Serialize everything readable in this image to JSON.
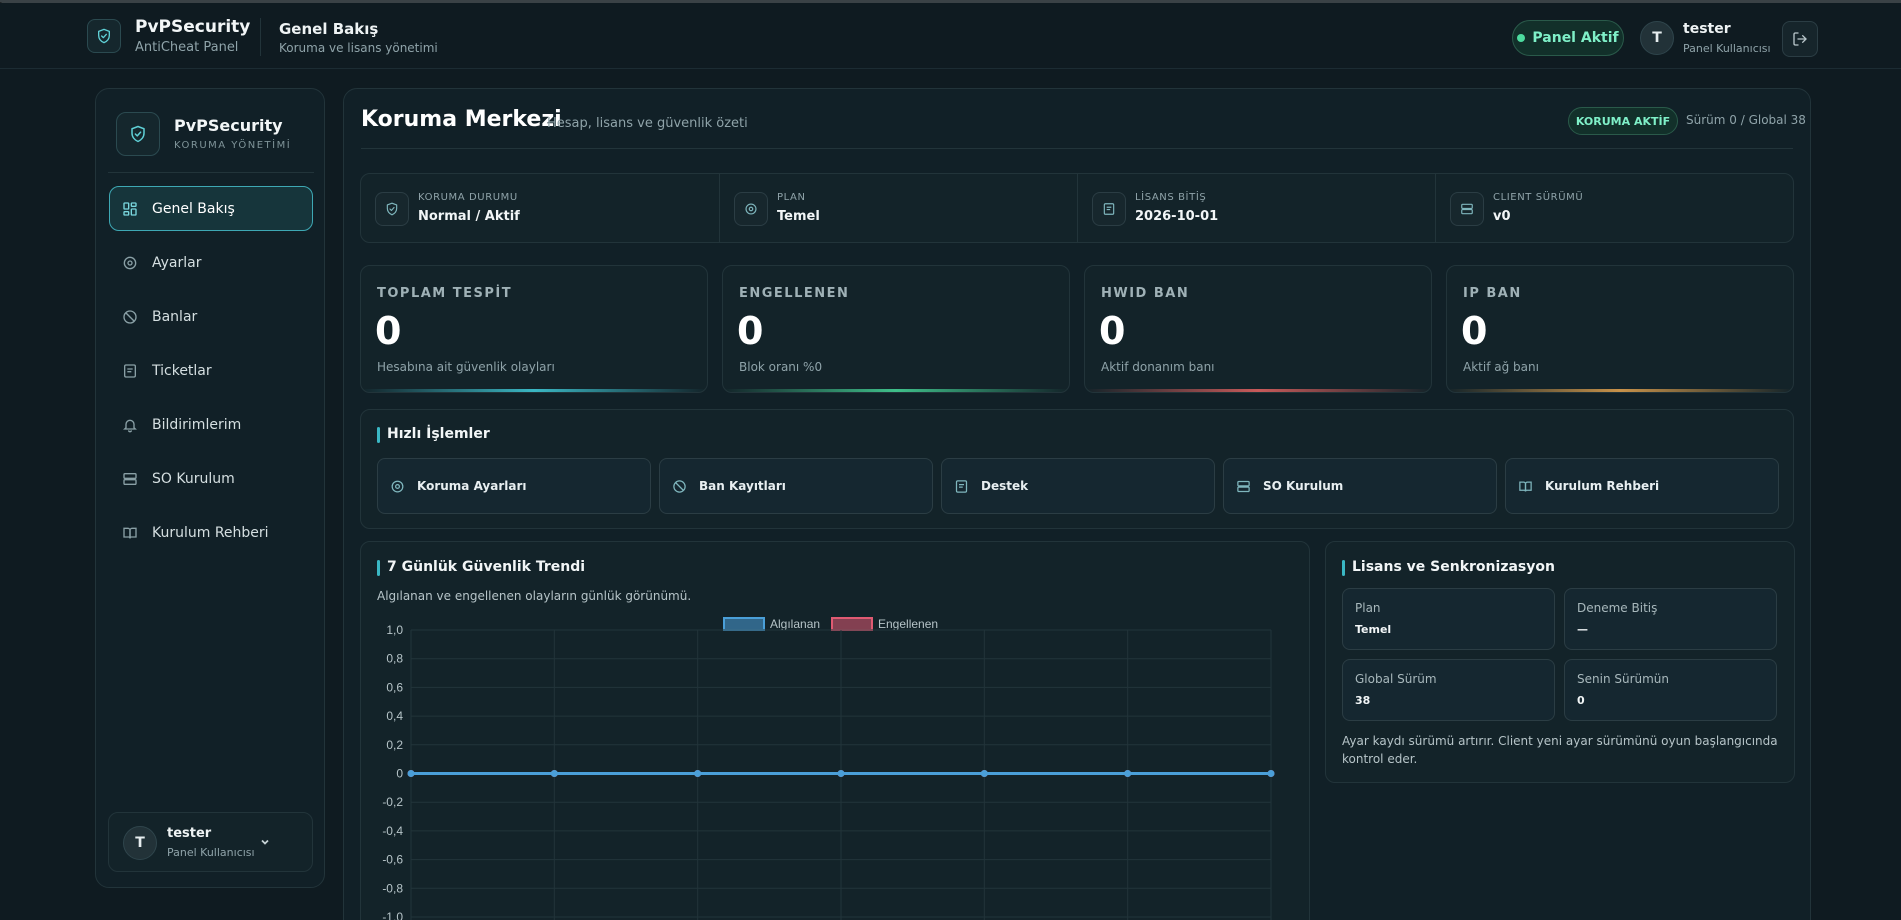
{
  "header": {
    "brand_name": "PvPSecurity",
    "brand_sub": "AntiCheat Panel",
    "title": "Genel Bakış",
    "subtitle": "Koruma ve lisans yönetimi",
    "status_pill": "Panel Aktif",
    "user_initial": "T",
    "user_name": "tester",
    "user_role": "Panel Kullanıcısı"
  },
  "sidebar": {
    "brand_name": "PvPSecurity",
    "brand_sub": "KORUMA YÖNETİMİ",
    "items": [
      {
        "label": "Genel Bakış",
        "icon": "grid-icon",
        "active": true
      },
      {
        "label": "Ayarlar",
        "icon": "settings-icon",
        "active": false
      },
      {
        "label": "Banlar",
        "icon": "ban-icon",
        "active": false
      },
      {
        "label": "Ticketlar",
        "icon": "ticket-icon",
        "active": false
      },
      {
        "label": "Bildirimlerim",
        "icon": "bell-icon",
        "active": false
      },
      {
        "label": "SO Kurulum",
        "icon": "server-icon",
        "active": false
      },
      {
        "label": "Kurulum Rehberi",
        "icon": "book-icon",
        "active": false
      }
    ],
    "user_initial": "T",
    "user_name": "tester",
    "user_role": "Panel Kullanıcısı"
  },
  "main": {
    "title": "Koruma Merkezi",
    "subtitle": "Hesap, lisans ve güvenlik özeti",
    "badge": "KORUMA AKTİF",
    "version_text": "Sürüm 0 / Global 38",
    "info": [
      {
        "label": "KORUMA DURUMU",
        "value": "Normal / Aktif",
        "icon": "shield-icon"
      },
      {
        "label": "PLAN",
        "value": "Temel",
        "icon": "settings-icon"
      },
      {
        "label": "LİSANS BİTİŞ",
        "value": "2026-10-01",
        "icon": "document-icon"
      },
      {
        "label": "CLIENT SÜRÜMÜ",
        "value": "v0",
        "icon": "server-icon"
      }
    ],
    "stats": [
      {
        "label": "TOPLAM TESPİT",
        "value": "0",
        "desc": "Hesabına ait güvenlik olayları",
        "color": "#3ab7c4"
      },
      {
        "label": "ENGELLENEN",
        "value": "0",
        "desc": "Blok oranı %0",
        "color": "#3fbf8a"
      },
      {
        "label": "HWID BAN",
        "value": "0",
        "desc": "Aktif donanım banı",
        "color": "#c85a5a"
      },
      {
        "label": "IP BAN",
        "value": "0",
        "desc": "Aktif ağ banı",
        "color": "#c8924a"
      }
    ],
    "quick": {
      "title": "Hızlı İşlemler",
      "buttons": [
        {
          "label": "Koruma Ayarları",
          "icon": "settings-icon"
        },
        {
          "label": "Ban Kayıtları",
          "icon": "ban-icon"
        },
        {
          "label": "Destek",
          "icon": "ticket-icon"
        },
        {
          "label": "SO Kurulum",
          "icon": "server-icon"
        },
        {
          "label": "Kurulum Rehberi",
          "icon": "book-icon"
        }
      ]
    },
    "trend": {
      "title": "7 Günlük Güvenlik Trendi",
      "subtitle": "Algılanan ve engellenen olayların günlük görünümü."
    },
    "license": {
      "title": "Lisans ve Senkronizasyon",
      "cells": [
        {
          "label": "Plan",
          "value": "Temel"
        },
        {
          "label": "Deneme Bitiş",
          "value": "—"
        },
        {
          "label": "Global Sürüm",
          "value": "38"
        },
        {
          "label": "Senin Sürümün",
          "value": "0"
        }
      ],
      "note": "Ayar kaydı sürümü artırır. Client yeni ayar sürümünü oyun başlangıcında kontrol eder."
    }
  },
  "chart_data": {
    "type": "line",
    "title": "",
    "xlabel": "",
    "ylabel": "",
    "x": [
      "",
      "",
      "",
      "",
      "",
      "",
      ""
    ],
    "series": [
      {
        "name": "Algılanan",
        "values": [
          0,
          0,
          0,
          0,
          0,
          0,
          0
        ],
        "color": "#4a9fd8"
      },
      {
        "name": "Engellenen",
        "values": [
          0,
          0,
          0,
          0,
          0,
          0,
          0
        ],
        "color": "#e05a72"
      }
    ],
    "ylim": [
      -1.0,
      1.0
    ],
    "yticks": [
      "1,0",
      "0,8",
      "0,6",
      "0,4",
      "0,2",
      "0",
      "-0,2",
      "-0,4",
      "-0,6",
      "-0,8",
      "-1,0"
    ],
    "legend": "top-center",
    "grid": true
  }
}
